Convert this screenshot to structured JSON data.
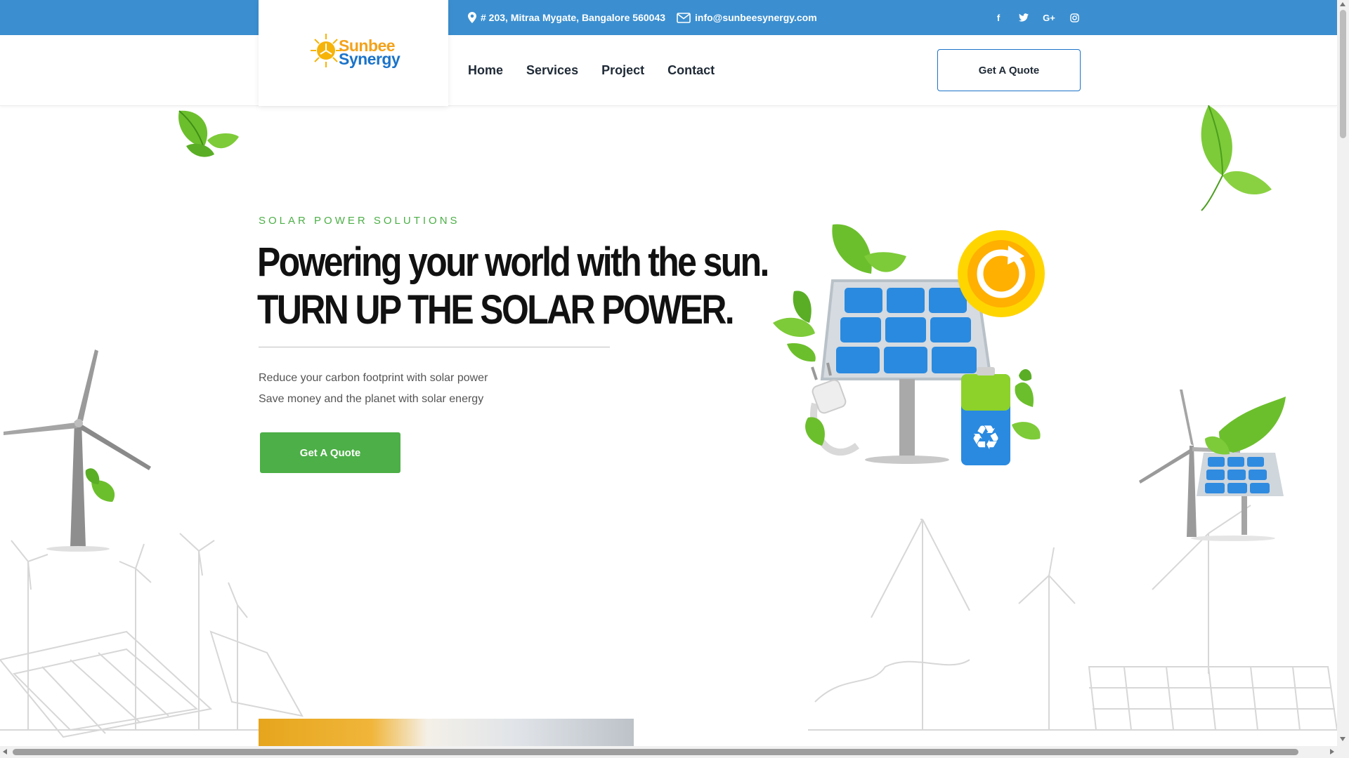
{
  "topbar": {
    "address": "# 203, Mitraa Mygate, Bangalore 560043",
    "email": "info@sunbeesynergy.com",
    "social": [
      {
        "name": "facebook-icon",
        "glyph": "f"
      },
      {
        "name": "twitter-icon",
        "glyph": "🐦"
      },
      {
        "name": "google-plus-icon",
        "glyph": "G+"
      },
      {
        "name": "instagram-icon",
        "glyph": "◎"
      }
    ],
    "color": "#3b8fd0"
  },
  "logo": {
    "line1": "Sunbee",
    "line2": "Synergy"
  },
  "nav": {
    "items": [
      "Home",
      "Services",
      "Project",
      "Contact"
    ],
    "quote_button": "Get A Quote"
  },
  "hero": {
    "eyebrow": "SOLAR POWER SOLUTIONS",
    "headline_line1": "Powering your world with the sun.",
    "headline_line2": "TURN UP THE SOLAR POWER.",
    "desc_line1": "Reduce your carbon footprint with solar power",
    "desc_line2": "Save money and the planet with solar energy",
    "cta": "Get A Quote",
    "accent_color": "#4caf47"
  }
}
